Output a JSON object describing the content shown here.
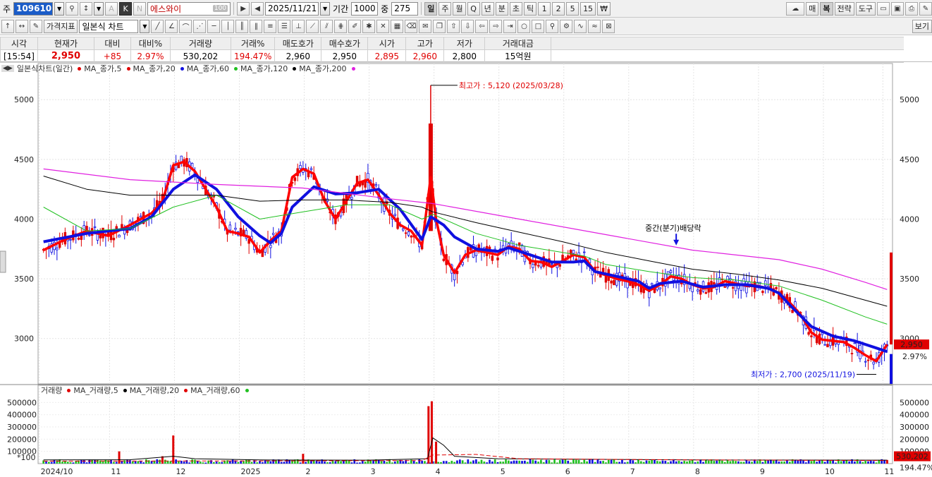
{
  "toolbar1": {
    "prefix_label": "주",
    "stock_code": "109610",
    "stock_name": "에스와이",
    "name_badge": "100",
    "date": "2025/11/21",
    "period_label": "기간",
    "period_value": "1000",
    "middle_label": "중",
    "middle_value": "275",
    "btn_k": "K",
    "btn_a": "A",
    "btn_n": "N",
    "periods": [
      "일",
      "주",
      "월",
      "Q",
      "년",
      "분",
      "초",
      "틱",
      "1",
      "2",
      "5",
      "15",
      "₩"
    ],
    "right_buttons": [
      "매",
      "복",
      "전략",
      "도구"
    ]
  },
  "toolbar2": {
    "indicator_button": "가격지표",
    "chart_type": "일본식 차트",
    "view_button": "보기"
  },
  "quote": {
    "headers": [
      "시각",
      "현재가",
      "대비",
      "대비%",
      "거래량",
      "거래%",
      "매도호가",
      "매수호가",
      "시가",
      "고가",
      "저가",
      "거래대금"
    ],
    "values": [
      "[15:54]",
      "2,950",
      "+85",
      "2.97%",
      "530,202",
      "194.47%",
      "2,960",
      "2,950",
      "2,895",
      "2,960",
      "2,800",
      "15억원"
    ]
  },
  "price_panel": {
    "legend_title": "일본식차트(일간)",
    "ma_legend": [
      {
        "label": "MA_종가,5",
        "color": "#e00000"
      },
      {
        "label": "MA_종가,20",
        "color": "#e00000"
      },
      {
        "label": "MA_종가,60",
        "color": "#1010e0"
      },
      {
        "label": "MA_종가,120",
        "color": "#20c020"
      },
      {
        "label": "MA_종가,200",
        "color": "#000000"
      }
    ],
    "ma200_marker_color": "#e020e0",
    "high_annotation": "최고가 : 5,120 (2025/03/28)",
    "low_annotation": "최저가 : 2,700 (2025/11/19)",
    "dividend_annotation": "중간(분기)배당락",
    "current_price_tag": "2,950",
    "current_pct_tag": "2.97%",
    "colors": {
      "up": "#e00000",
      "down": "#1010e0",
      "ma5": "#ff0000",
      "ma20": "#1010e0",
      "ma60": "#20c020",
      "ma120": "#000000",
      "ma200": "#e020e0"
    }
  },
  "volume_panel": {
    "legend_title": "거래량",
    "ma_legend": [
      {
        "label": "MA_거래량,5",
        "color": "#e00000"
      },
      {
        "label": "MA_거래량,20",
        "color": "#000000"
      },
      {
        "label": "MA_거래량,60",
        "color": "#20c020"
      }
    ],
    "multiplier": "*100",
    "current_volume_tag": "530,202",
    "current_pct_tag": "194.47%"
  },
  "chart_data": [
    {
      "type": "candlestick",
      "title": "일본식차트(일간)",
      "y_ticks": [
        3000,
        3500,
        4000,
        4500,
        5000
      ],
      "ylim": [
        2620,
        5220
      ],
      "x_ticks": [
        "2024/10",
        "11",
        "12",
        "2025",
        "2",
        "3",
        "4",
        "5",
        "6",
        "7",
        "8",
        "9",
        "10",
        "11"
      ],
      "series": [
        {
          "name": "MA_종가,5",
          "points": [
            [
              0,
              3740
            ],
            [
              2,
              3830
            ],
            [
              4,
              3900
            ],
            [
              6,
              3860
            ],
            [
              8,
              3950
            ],
            [
              10,
              4050
            ],
            [
              11,
              4150
            ],
            [
              12,
              4450
            ],
            [
              13,
              4480
            ],
            [
              14,
              4400
            ],
            [
              15,
              4250
            ],
            [
              16,
              4100
            ],
            [
              17,
              3900
            ],
            [
              18,
              3880
            ],
            [
              19,
              3850
            ],
            [
              20,
              3720
            ],
            [
              21,
              3820
            ],
            [
              22,
              3900
            ],
            [
              23,
              4350
            ],
            [
              24,
              4420
            ],
            [
              25,
              4380
            ],
            [
              26,
              4150
            ],
            [
              27,
              4000
            ],
            [
              28,
              4150
            ],
            [
              29,
              4300
            ],
            [
              30,
              4330
            ],
            [
              31,
              4200
            ],
            [
              32,
              4050
            ],
            [
              33,
              3950
            ],
            [
              34,
              3900
            ],
            [
              35,
              3780
            ],
            [
              35.8,
              4350
            ],
            [
              36.3,
              4000
            ],
            [
              37,
              3700
            ],
            [
              38,
              3550
            ],
            [
              39,
              3700
            ],
            [
              40,
              3740
            ],
            [
              41,
              3720
            ],
            [
              42,
              3700
            ],
            [
              43,
              3770
            ],
            [
              44,
              3750
            ],
            [
              45,
              3650
            ],
            [
              46,
              3640
            ],
            [
              47,
              3600
            ],
            [
              48,
              3650
            ],
            [
              49,
              3700
            ],
            [
              50,
              3680
            ],
            [
              51,
              3560
            ],
            [
              52,
              3530
            ],
            [
              53,
              3500
            ],
            [
              54,
              3480
            ],
            [
              55,
              3450
            ],
            [
              56,
              3400
            ],
            [
              57,
              3450
            ],
            [
              58,
              3520
            ],
            [
              59,
              3500
            ],
            [
              60,
              3450
            ],
            [
              61,
              3420
            ],
            [
              62,
              3430
            ],
            [
              63,
              3480
            ],
            [
              64,
              3460
            ],
            [
              65,
              3440
            ],
            [
              66,
              3440
            ],
            [
              67,
              3420
            ],
            [
              68,
              3380
            ],
            [
              69,
              3300
            ],
            [
              70,
              3200
            ],
            [
              71,
              3050
            ],
            [
              72,
              2990
            ],
            [
              73,
              2980
            ],
            [
              74,
              2970
            ],
            [
              75,
              2920
            ],
            [
              76,
              2860
            ],
            [
              77,
              2810
            ],
            [
              78,
              2950
            ]
          ]
        },
        {
          "name": "MA_종가,60",
          "points": [
            [
              0,
              3810
            ],
            [
              4,
              3880
            ],
            [
              8,
              3920
            ],
            [
              10,
              4020
            ],
            [
              12,
              4250
            ],
            [
              14,
              4370
            ],
            [
              16,
              4250
            ],
            [
              18,
              4020
            ],
            [
              20,
              3860
            ],
            [
              21,
              3800
            ],
            [
              22,
              3880
            ],
            [
              23,
              4100
            ],
            [
              25,
              4270
            ],
            [
              27,
              4210
            ],
            [
              29,
              4220
            ],
            [
              31,
              4250
            ],
            [
              33,
              4080
            ],
            [
              35,
              3830
            ],
            [
              35.8,
              4020
            ],
            [
              37,
              3950
            ],
            [
              38,
              3850
            ],
            [
              40,
              3750
            ],
            [
              42,
              3730
            ],
            [
              43,
              3760
            ],
            [
              45,
              3700
            ],
            [
              47,
              3640
            ],
            [
              49,
              3640
            ],
            [
              50,
              3650
            ],
            [
              51,
              3560
            ],
            [
              53,
              3520
            ],
            [
              55,
              3480
            ],
            [
              56,
              3420
            ],
            [
              57,
              3460
            ],
            [
              59,
              3480
            ],
            [
              61,
              3430
            ],
            [
              63,
              3450
            ],
            [
              65,
              3450
            ],
            [
              67,
              3420
            ],
            [
              68,
              3380
            ],
            [
              69,
              3280
            ],
            [
              71,
              3100
            ],
            [
              73,
              3020
            ],
            [
              75,
              2980
            ],
            [
              77,
              2920
            ],
            [
              78,
              2890
            ]
          ]
        },
        {
          "name": "MA_종가,120",
          "points": [
            [
              0,
              4100
            ],
            [
              4,
              3900
            ],
            [
              8,
              3920
            ],
            [
              12,
              4100
            ],
            [
              16,
              4200
            ],
            [
              20,
              4000
            ],
            [
              24,
              4060
            ],
            [
              28,
              4120
            ],
            [
              32,
              4120
            ],
            [
              35,
              4000
            ],
            [
              36,
              4040
            ],
            [
              40,
              3880
            ],
            [
              44,
              3780
            ],
            [
              48,
              3720
            ],
            [
              50,
              3690
            ],
            [
              52,
              3620
            ],
            [
              56,
              3560
            ],
            [
              60,
              3510
            ],
            [
              64,
              3490
            ],
            [
              68,
              3440
            ],
            [
              72,
              3320
            ],
            [
              76,
              3180
            ],
            [
              78,
              3120
            ]
          ]
        },
        {
          "name": "MA_종가,200",
          "points": [
            [
              0,
              4360
            ],
            [
              4,
              4250
            ],
            [
              8,
              4200
            ],
            [
              12,
              4200
            ],
            [
              16,
              4200
            ],
            [
              20,
              4150
            ],
            [
              24,
              4160
            ],
            [
              28,
              4160
            ],
            [
              32,
              4140
            ],
            [
              35,
              4100
            ],
            [
              36,
              4060
            ],
            [
              40,
              3970
            ],
            [
              44,
              3890
            ],
            [
              48,
              3810
            ],
            [
              52,
              3720
            ],
            [
              56,
              3650
            ],
            [
              60,
              3580
            ],
            [
              64,
              3540
            ],
            [
              68,
              3490
            ],
            [
              72,
              3420
            ],
            [
              76,
              3320
            ],
            [
              78,
              3270
            ]
          ]
        },
        {
          "name": "MA_종가,20",
          "points": [
            [
              0,
              4420
            ],
            [
              8,
              4330
            ],
            [
              16,
              4290
            ],
            [
              24,
              4260
            ],
            [
              32,
              4170
            ],
            [
              36,
              4130
            ],
            [
              44,
              4000
            ],
            [
              52,
              3870
            ],
            [
              60,
              3740
            ],
            [
              68,
              3660
            ],
            [
              72,
              3580
            ],
            [
              76,
              3470
            ],
            [
              78,
              3410
            ]
          ]
        }
      ]
    },
    {
      "type": "bar",
      "title": "거래량",
      "y_ticks": [
        100000,
        200000,
        300000,
        400000,
        500000
      ],
      "ylim": [
        0,
        560000
      ],
      "spikes": [
        [
          7,
          100000
        ],
        [
          11,
          60000
        ],
        [
          12,
          230000
        ],
        [
          24,
          80000
        ],
        [
          35.6,
          470000
        ],
        [
          35.9,
          510000
        ],
        [
          36.3,
          180000
        ],
        [
          78,
          30000
        ]
      ]
    }
  ]
}
